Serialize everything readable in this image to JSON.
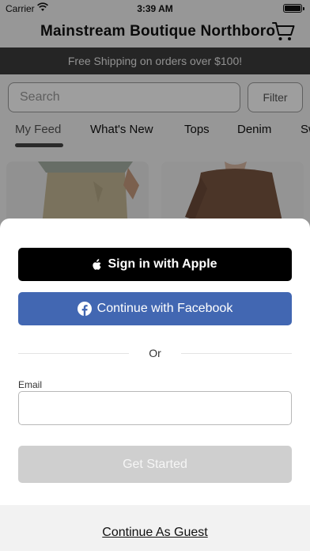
{
  "status_bar": {
    "carrier": "Carrier",
    "time": "3:39 AM"
  },
  "header": {
    "store_name": "Mainstream Boutique Northboro",
    "cart_icon": "cart-icon"
  },
  "promo_banner": {
    "text": "Free Shipping on orders over $100!"
  },
  "search": {
    "placeholder": "Search",
    "filter_label": "Filter"
  },
  "tabs": [
    {
      "label": "My Feed",
      "active": true
    },
    {
      "label": "What's New"
    },
    {
      "label": "Tops"
    },
    {
      "label": "Denim"
    },
    {
      "label": "Sw"
    }
  ],
  "sign_in": {
    "apple_label": "Sign in with Apple",
    "facebook_label": "Continue with Facebook",
    "or_text": "Or",
    "email_label": "Email",
    "email_value": "",
    "get_started_label": "Get Started",
    "guest_label": "Continue As Guest"
  },
  "colors": {
    "facebook": "#4267b2",
    "apple": "#000000",
    "promo_bg": "#3d3d3d",
    "disabled_button": "#cfcfcf"
  }
}
